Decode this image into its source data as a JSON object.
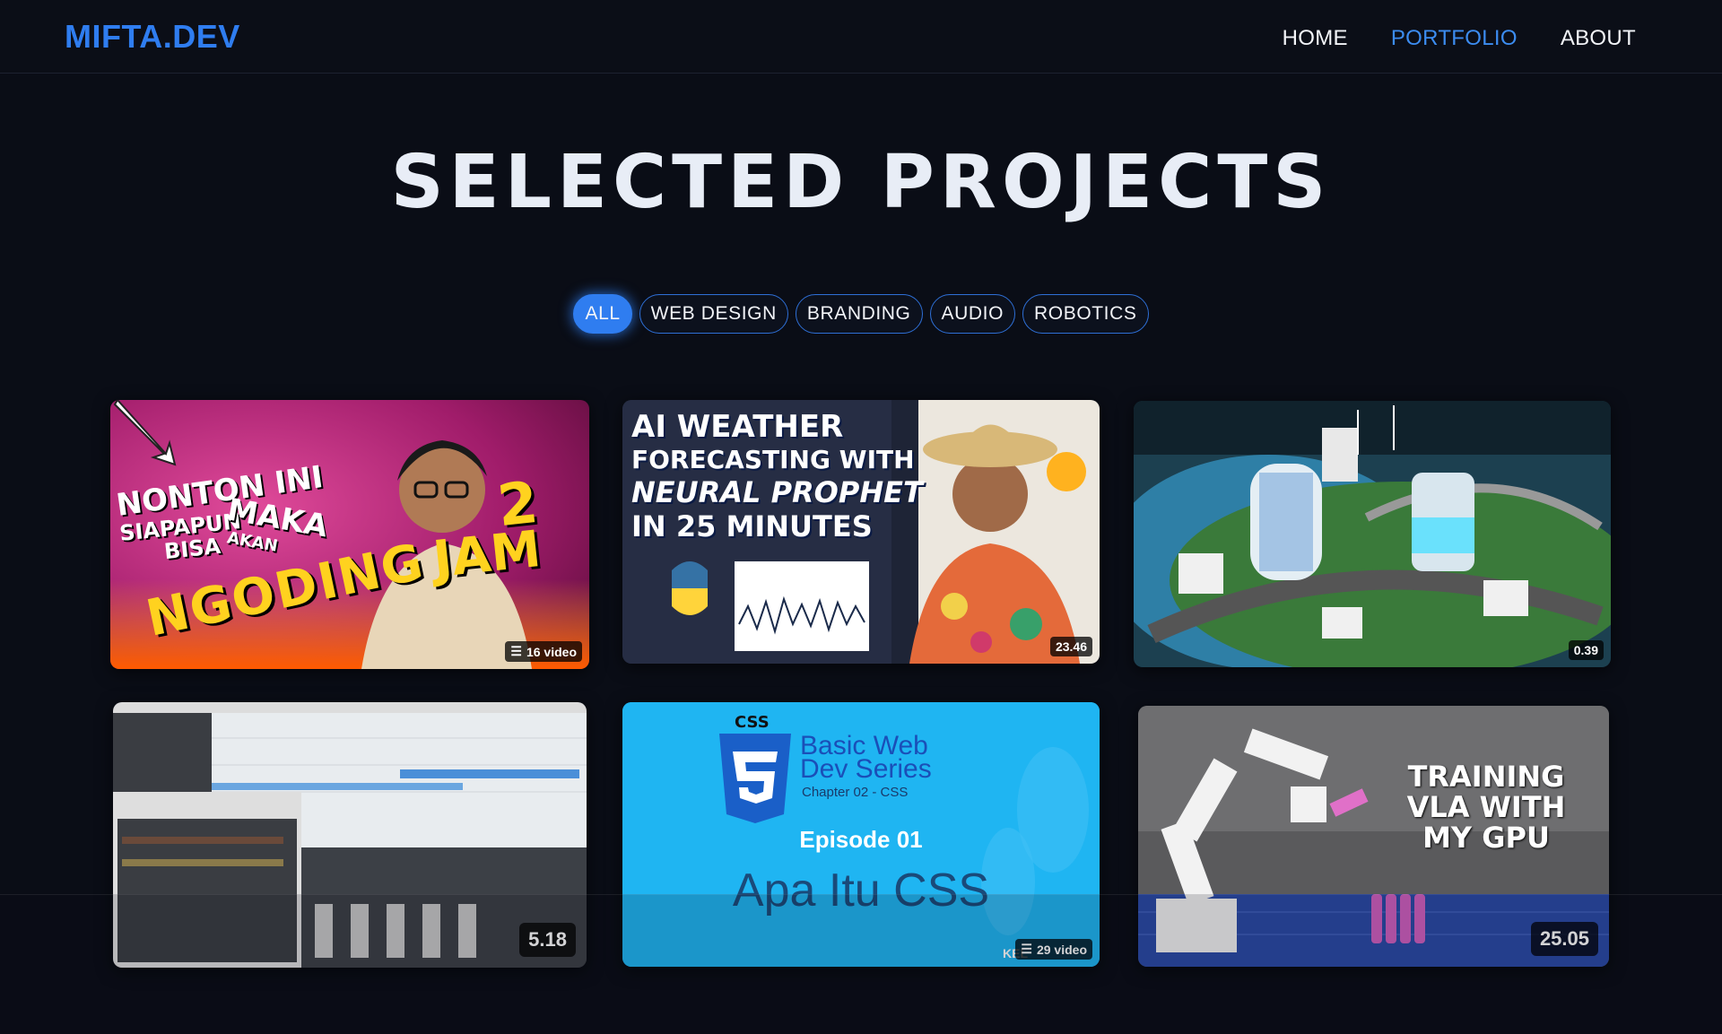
{
  "nav": {
    "logo": "MIFTA.DEV",
    "links": [
      "HOME",
      "PORTFOLIO",
      "ABOUT"
    ],
    "active_link": "PORTFOLIO"
  },
  "hero": {
    "title": "SELECTED PROJECTS"
  },
  "filters": {
    "items": [
      "ALL",
      "WEB DESIGN",
      "BRANDING",
      "AUDIO",
      "ROBOTICS"
    ],
    "active": "ALL"
  },
  "projects": [
    {
      "thumb_text": [
        "NONTON INI",
        "SIAPAPUN",
        "MAKA",
        "AKAN",
        "BISA",
        "NGODING",
        "2",
        "JAM"
      ],
      "badge": "16 video",
      "badge_icon": "playlist-icon"
    },
    {
      "thumb_text": [
        "AI WEATHER",
        "FORECASTING WITH",
        "NEURAL PROPHET",
        "IN 25 MINUTES"
      ],
      "badge": "23.46"
    },
    {
      "thumb_text": [],
      "badge": "0.39"
    },
    {
      "thumb_text": [],
      "badge": "5.18"
    },
    {
      "thumb_text": [
        "CSS",
        "Basic Web",
        "Dev Series",
        "Chapter 02 - CSS",
        "Episode 01",
        "Apa Itu CSS",
        "KEL"
      ],
      "badge": "29 video",
      "badge_icon": "playlist-icon"
    },
    {
      "thumb_text": [
        "TRAINING",
        "VLA WITH",
        "MY GPU"
      ],
      "badge": "25.05"
    }
  ],
  "colors": {
    "background": "#0a0d16",
    "accent": "#2f7df0",
    "active_link": "#3c8cf0"
  }
}
